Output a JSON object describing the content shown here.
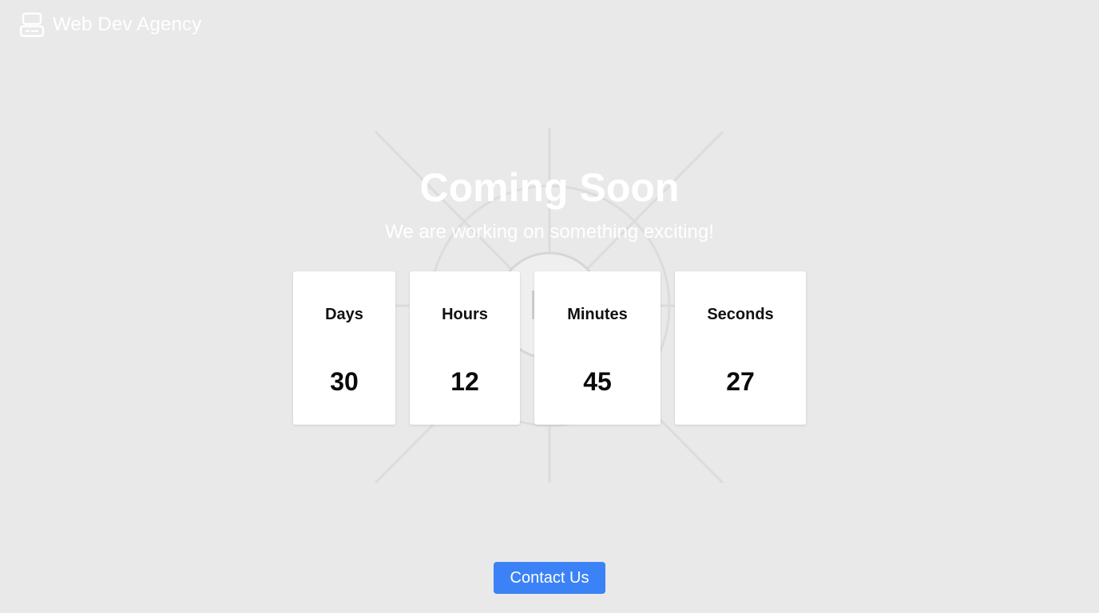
{
  "header": {
    "brand_name": "Web Dev Agency",
    "brand_icon": "server-icon"
  },
  "hero": {
    "title": "Coming Soon",
    "subtitle": "We are working on something exciting!"
  },
  "countdown": [
    {
      "label": "Days",
      "value": "30"
    },
    {
      "label": "Hours",
      "value": "12"
    },
    {
      "label": "Minutes",
      "value": "45"
    },
    {
      "label": "Seconds",
      "value": "27"
    }
  ],
  "footer": {
    "contact_label": "Contact Us"
  },
  "colors": {
    "background": "#e9e9e9",
    "accent": "#3b82f6",
    "card": "#ffffff",
    "text_dark": "#111111"
  }
}
